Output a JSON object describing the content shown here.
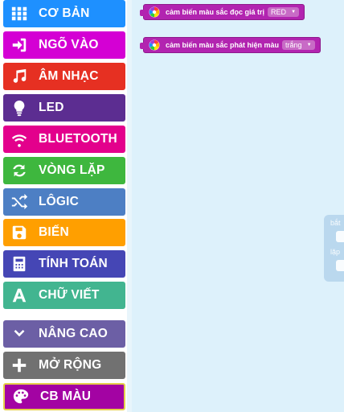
{
  "toolbox": {
    "items": [
      {
        "label": "CƠ BẢN",
        "icon": "grid-icon",
        "color": "#1e90ff"
      },
      {
        "label": "NGÕ VÀO",
        "icon": "sign-in-icon",
        "color": "#d400d4"
      },
      {
        "label": "ÂM NHẠC",
        "icon": "music-icon",
        "color": "#e63022"
      },
      {
        "label": "LED",
        "icon": "bulb-icon",
        "color": "#5c2d91"
      },
      {
        "label": "BLUETOOTH",
        "icon": "wifi-icon",
        "color": "#e3008c"
      },
      {
        "label": "VÒNG LẶP",
        "icon": "refresh-icon",
        "color": "#3eb73e"
      },
      {
        "label": "LÔGIC",
        "icon": "shuffle-icon",
        "color": "#4d7fc4"
      },
      {
        "label": "BIẾN",
        "icon": "save-icon",
        "color": "#ff9f00"
      },
      {
        "label": "TÍNH TOÁN",
        "icon": "calculator-icon",
        "color": "#4546b5"
      },
      {
        "label": "CHỮ VIẾT",
        "icon": "text-a-icon",
        "color": "#42b590"
      },
      {
        "label": "NÂNG CAO",
        "icon": "chevron-down-icon",
        "color": "#6c5fa5"
      },
      {
        "label": "MỞ RỘNG",
        "icon": "plus-icon",
        "color": "#717171"
      },
      {
        "label": "CB MÀU",
        "icon": "palette-icon",
        "color": "#a303a3"
      }
    ],
    "selected_index": 12,
    "selected_border_color": "#e4d04a"
  },
  "workspace": {
    "background": "#ddf1fb",
    "blocks": [
      {
        "label": "cảm biến màu sắc đọc giá trị",
        "icon": "color-sensor-icon",
        "dropdown": "RED",
        "color": "#b224b0"
      },
      {
        "label": "cảm biến màu sắc phát hiện màu",
        "icon": "color-sensor-icon",
        "dropdown": "trắng",
        "color": "#b224b0"
      }
    ]
  },
  "flyout_ghost": {
    "text_top": "bắt",
    "text_bottom": "lặp"
  }
}
